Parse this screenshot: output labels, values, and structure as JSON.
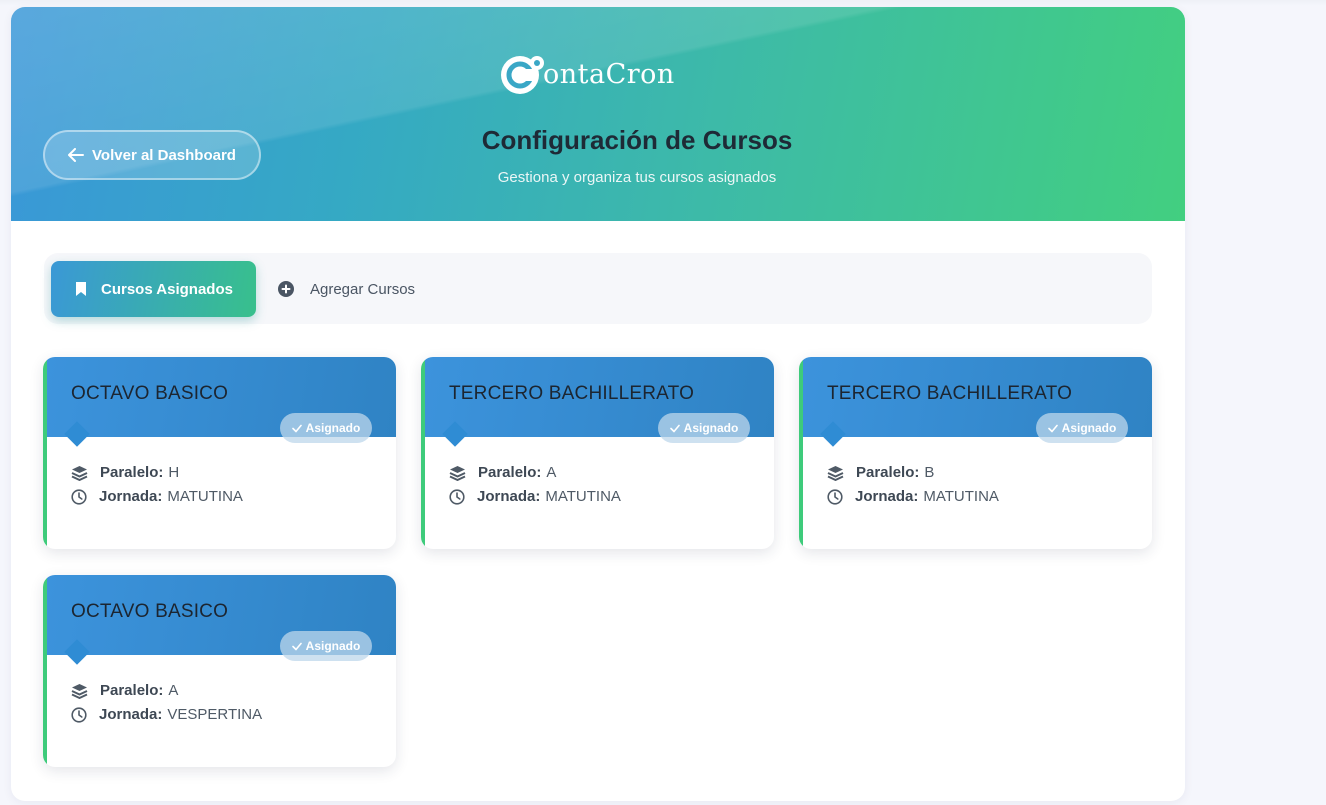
{
  "brand": {
    "logo_text": "ontaCron",
    "logo_letter": "C"
  },
  "header": {
    "back_label": "Volver al Dashboard",
    "title": "Configuración de Cursos",
    "subtitle": "Gestiona y organiza tus cursos asignados"
  },
  "tabs": [
    {
      "label": "Cursos Asignados",
      "active": true,
      "icon": "bookmark-icon"
    },
    {
      "label": "Agregar Cursos",
      "active": false,
      "icon": "plus-circle-icon"
    }
  ],
  "labels": {
    "paralelo": "Paralelo:",
    "jornada": "Jornada:"
  },
  "courses": [
    {
      "title": "OCTAVO BASICO",
      "badge": "Asignado",
      "paralelo": "H",
      "jornada": "MATUTINA"
    },
    {
      "title": "TERCERO BACHILLERATO",
      "badge": "Asignado",
      "paralelo": "A",
      "jornada": "MATUTINA"
    },
    {
      "title": "TERCERO BACHILLERATO",
      "badge": "Asignado",
      "paralelo": "B",
      "jornada": "MATUTINA"
    },
    {
      "title": "OCTAVO BASICO",
      "badge": "Asignado",
      "paralelo": "A",
      "jornada": "VESPERTINA"
    }
  ],
  "colors": {
    "gradient_start": "#3a97d8",
    "gradient_end": "#42cf80",
    "card_header": "#3c93dc",
    "card_accent": "#3ecb7b",
    "title_text": "#1e2a36"
  }
}
